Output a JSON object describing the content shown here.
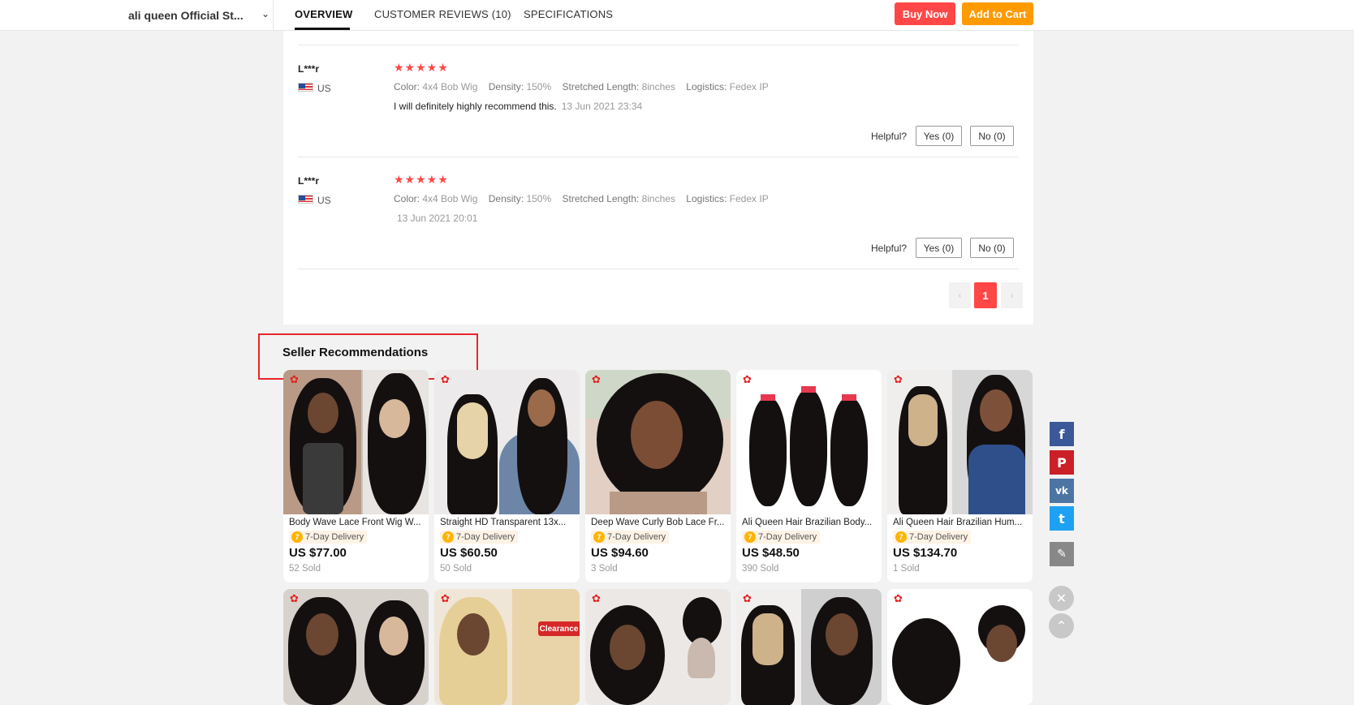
{
  "header": {
    "store_name": "ali queen Official St...",
    "tabs": [
      "OVERVIEW",
      "CUSTOMER REVIEWS (10)",
      "SPECIFICATIONS"
    ],
    "buy_now": "Buy Now",
    "add_to_cart": "Add to Cart"
  },
  "reviews": [
    {
      "reviewer": "L***r",
      "country": "US",
      "stars": "★★★★★",
      "color_label": "Color:",
      "color": "4x4 Bob Wig",
      "density_label": "Density:",
      "density": "150%",
      "length_label": "Stretched Length:",
      "length": "8inches",
      "logistics_label": "Logistics:",
      "logistics": "Fedex IP",
      "text": "I will definitely highly recommend this.",
      "date": "13 Jun 2021 23:34",
      "helpful": "Helpful?",
      "yes": "Yes (0)",
      "no": "No (0)"
    },
    {
      "reviewer": "L***r",
      "country": "US",
      "stars": "★★★★★",
      "color_label": "Color:",
      "color": "4x4 Bob Wig",
      "density_label": "Density:",
      "density": "150%",
      "length_label": "Stretched Length:",
      "length": "8inches",
      "logistics_label": "Logistics:",
      "logistics": "Fedex IP",
      "text": "",
      "date": "13 Jun 2021 20:01",
      "helpful": "Helpful?",
      "yes": "Yes (0)",
      "no": "No (0)"
    }
  ],
  "pagination": {
    "prev": "‹",
    "current": "1",
    "next": "›"
  },
  "recommendations": {
    "title": "Seller Recommendations",
    "delivery_label": "7-Day Delivery",
    "products": [
      {
        "name": "Body Wave Lace Front Wig W...",
        "price": "US $77.00",
        "sold": "52 Sold"
      },
      {
        "name": "Straight HD Transparent 13x...",
        "price": "US $60.50",
        "sold": "50 Sold"
      },
      {
        "name": "Deep Wave Curly Bob Lace Fr...",
        "price": "US $94.60",
        "sold": "3 Sold"
      },
      {
        "name": "Ali Queen Hair Brazilian Body...",
        "price": "US $48.50",
        "sold": "390 Sold"
      },
      {
        "name": "Ali Queen Hair Brazilian Hum...",
        "price": "US $134.70",
        "sold": "1 Sold"
      }
    ],
    "row2_badge": "Clearance"
  },
  "share": {
    "facebook": "f",
    "pinterest": "P",
    "vk": "vk",
    "twitter": "t",
    "colors": {
      "facebook": "#3b5998",
      "pinterest": "#cb2027",
      "vk": "#4c75a3",
      "twitter": "#1da1f2",
      "edit": "#888888"
    }
  },
  "colors": {
    "accent_red": "#ff4747",
    "accent_orange": "#ff9a00",
    "highlight": "#e8262b"
  }
}
